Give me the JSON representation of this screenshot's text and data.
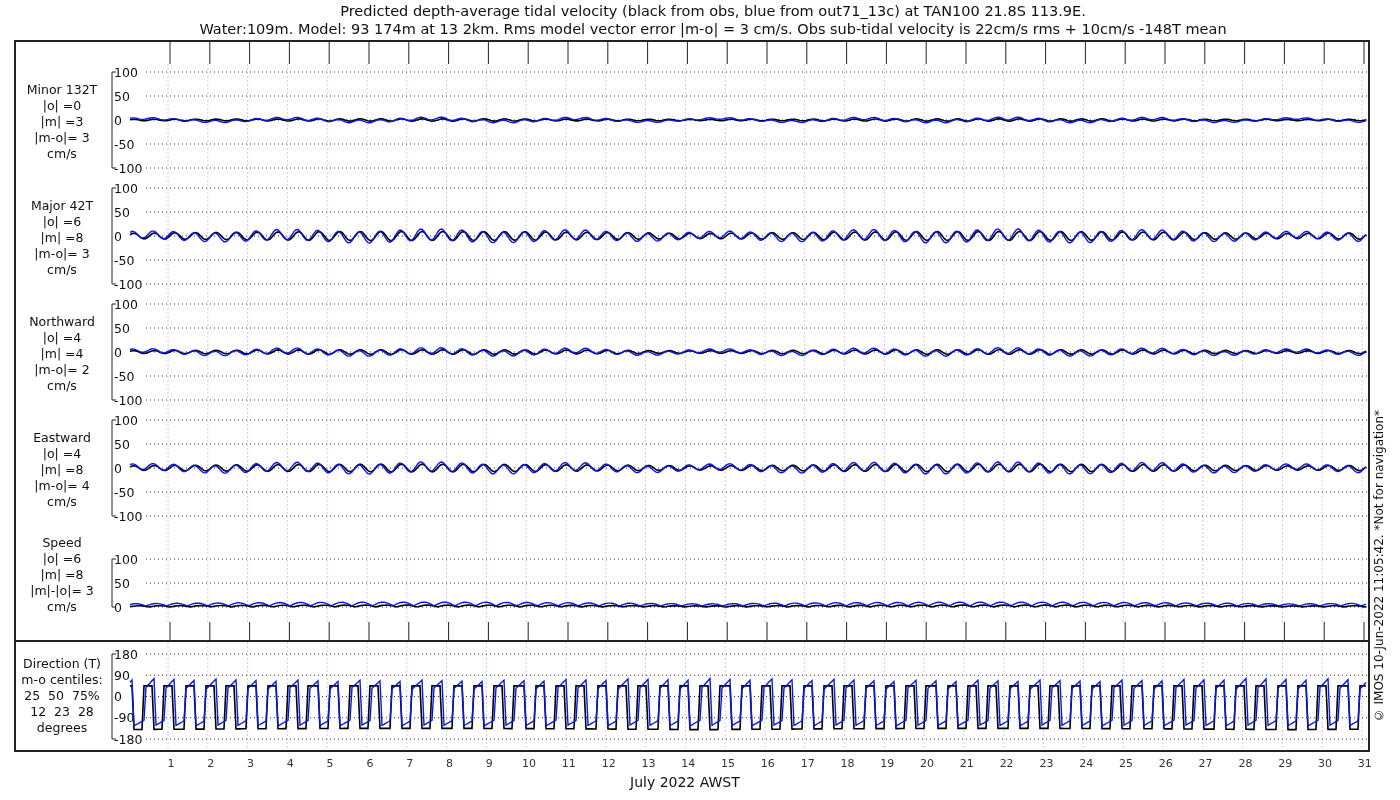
{
  "title": [
    "Predicted depth-average tidal velocity (black from obs, blue from out71_13c) at TAN100 21.8S 113.9E.",
    "Water:109m. Model: 93 174m at 13 2km. Rms model vector error |m-o| = 3 cm/s. Obs sub-tidal velocity is 22cm/s rms + 10cm/s -148T mean"
  ],
  "panels": [
    {
      "kind": "velocity",
      "label": [
        "Minor 132T",
        "|o| =0",
        "|m| =3",
        "|m-o|= 3",
        "cm/s"
      ],
      "yticks": [
        "100",
        "50",
        "0",
        "-50",
        "-100"
      ]
    },
    {
      "kind": "velocity",
      "label": [
        "Major 42T",
        "|o| =6",
        "|m| =8",
        "|m-o|= 3",
        "cm/s"
      ],
      "yticks": [
        "100",
        "50",
        "0",
        "-50",
        "-100"
      ]
    },
    {
      "kind": "velocity",
      "label": [
        "Northward",
        "|o| =4",
        "|m| =4",
        "|m-o|= 2",
        "cm/s"
      ],
      "yticks": [
        "100",
        "50",
        "0",
        "-50",
        "-100"
      ]
    },
    {
      "kind": "velocity",
      "label": [
        "Eastward",
        "|o| =4",
        "|m| =8",
        "|m-o|= 4",
        "cm/s"
      ],
      "yticks": [
        "100",
        "50",
        "0",
        "-50",
        "-100"
      ]
    },
    {
      "kind": "speed",
      "label": [
        "Speed",
        "|o| =6",
        "|m| =8",
        "|m|-|o|= 3",
        "cm/s"
      ],
      "yticks": [
        "100",
        "50",
        "0"
      ]
    },
    {
      "kind": "direction",
      "label": [
        "Direction (T)",
        "m-o centiles:",
        "25  50  75%",
        "12  23  28",
        "degrees"
      ],
      "yticks": [
        "180",
        "90",
        "0",
        "-90",
        "-180"
      ]
    }
  ],
  "xticks": [
    "1",
    "2",
    "3",
    "4",
    "5",
    "6",
    "7",
    "8",
    "9",
    "10",
    "11",
    "12",
    "13",
    "14",
    "15",
    "16",
    "17",
    "18",
    "19",
    "20",
    "21",
    "22",
    "23",
    "24",
    "25",
    "26",
    "27",
    "28",
    "29",
    "30",
    "31"
  ],
  "xlabel": "July 2022 AWST",
  "credit": "© IMOS 10-Jun-2022 11:05:42. *Not for navigation*"
}
